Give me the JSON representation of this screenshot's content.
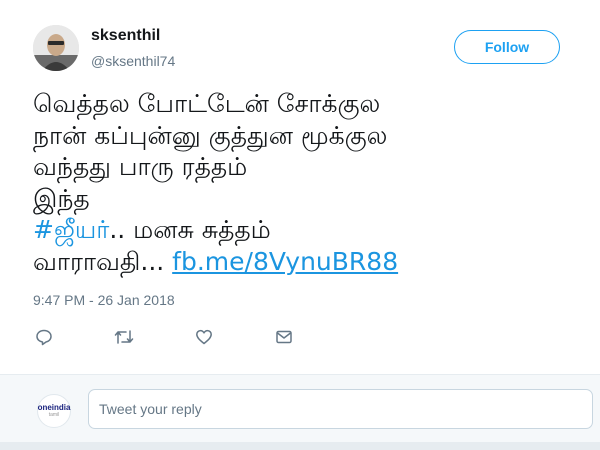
{
  "user": {
    "name": "sksenthil",
    "handle": "@sksenthil74"
  },
  "follow_label": "Follow",
  "tweet": {
    "lines": [
      "வெத்தல போட்டேன் சோக்குல",
      "நான் கப்புன்னு குத்துன மூக்குல",
      "வந்தது பாரு ரத்தம்",
      "இந்த"
    ],
    "hashtag": "#ஜீயர்",
    "after_hashtag": ".. மனசு சுத்தம்",
    "last_text": "வாராவதி... ",
    "link": "fb.me/8VynuBR88"
  },
  "timestamp": "9:47 PM - 26 Jan 2018",
  "actions": {
    "icons": [
      "reply-icon",
      "retweet-icon",
      "like-icon",
      "direct-message-icon"
    ]
  },
  "reply": {
    "placeholder": "Tweet your reply",
    "avatar_brand": "oneindia",
    "avatar_sub": "tamil"
  },
  "colors": {
    "accent": "#1da1f2",
    "link": "#1b95e0",
    "muted": "#657786",
    "text": "#14171a"
  }
}
